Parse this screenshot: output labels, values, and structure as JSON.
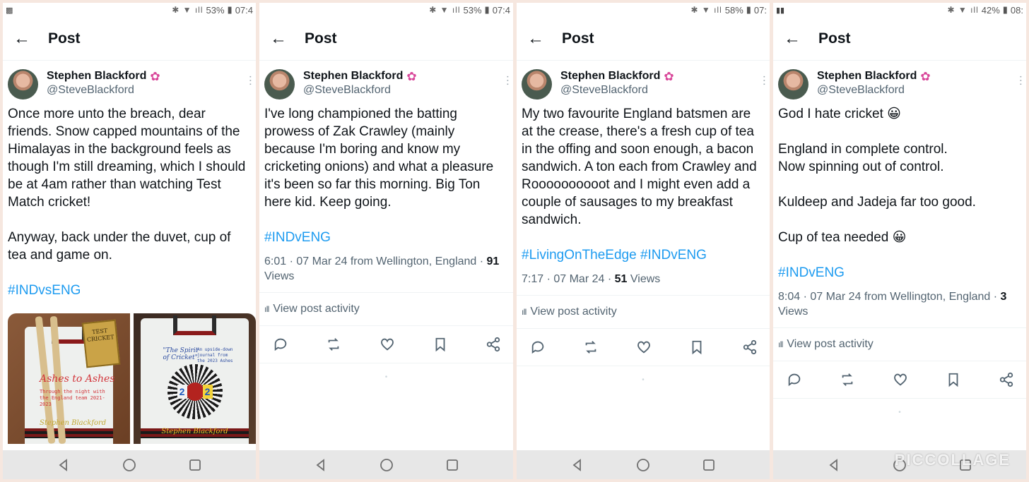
{
  "panels": [
    {
      "status": {
        "battery": "53%",
        "time": "07:4"
      },
      "header_title": "Post",
      "author": {
        "name": "Stephen Blackford",
        "handle": "@SteveBlackford"
      },
      "body": "Once more unto the breach, dear friends. Snow capped mountains of the Himalayas in the background feels as though I'm still dreaming, which I should be at 4am rather than watching Test Match cricket!\n\nAnyway, back under the duvet, cup of tea and game on.",
      "hashtags": "#INDvsENG",
      "photos": {
        "book1_title": "Ashes to Ashes",
        "book1_subtitle": "Through the night with the England team 2021-2023",
        "book1_author": "Stephen Blackford",
        "mini_book": "TEST CRICKET",
        "book2_title": "\"The Spirit of Cricket\"",
        "book2_subtitle": "An upside-down journal from the 2023 Ashes",
        "book2_num_left": "2",
        "book2_num_right": "2",
        "book2_author": "Stephen Blackford"
      }
    },
    {
      "status": {
        "battery": "53%",
        "time": "07:4"
      },
      "header_title": "Post",
      "author": {
        "name": "Stephen Blackford",
        "handle": "@SteveBlackford"
      },
      "body": "I've long championed the batting prowess of Zak Crawley (mainly because I'm boring and know my cricketing onions) and what a pleasure it's been so far this morning. Big Ton here kid. Keep going.",
      "hashtags": "#INDvENG",
      "meta_prefix": "6:01 · 07 Mar 24 from Wellington, England · ",
      "meta_views_count": "91",
      "meta_views_label": "Views",
      "activity_label": "View post activity"
    },
    {
      "status": {
        "battery": "58%",
        "time": "07:"
      },
      "header_title": "Post",
      "author": {
        "name": "Stephen Blackford",
        "handle": "@SteveBlackford"
      },
      "body": "My two favourite England batsmen are at the crease, there's a fresh cup of tea in the offing and soon enough, a bacon sandwich. A ton each from Crawley and Roooooooooot and I might even add a couple of sausages to my breakfast sandwich.",
      "hashtags": "#LivingOnTheEdge #INDvENG",
      "meta_prefix": "7:17 · 07 Mar 24 · ",
      "meta_views_count": "51",
      "meta_views_label": "Views",
      "activity_label": "View post activity"
    },
    {
      "status": {
        "battery": "42%",
        "time": "08:"
      },
      "header_title": "Post",
      "author": {
        "name": "Stephen Blackford",
        "handle": "@SteveBlackford"
      },
      "body": "God I hate cricket 😀\n\nEngland in complete control.\nNow spinning out of control.\n\nKuldeep and Jadeja far too good.\n\nCup of tea needed 😀",
      "hashtags": "#INDvENG",
      "meta_prefix": "8:04 · 07 Mar 24 from Wellington, England · ",
      "meta_views_count": "3",
      "meta_views_label": "Views",
      "activity_label": "View post activity"
    }
  ],
  "watermark": "PICCOLLAGE",
  "icons": [
    "back-arrow-icon",
    "flower-icon",
    "more-icon",
    "reply-icon",
    "repost-icon",
    "like-icon",
    "bookmark-icon",
    "share-icon",
    "analytics-icon",
    "nav-back-icon",
    "nav-home-icon",
    "nav-recents-icon"
  ]
}
